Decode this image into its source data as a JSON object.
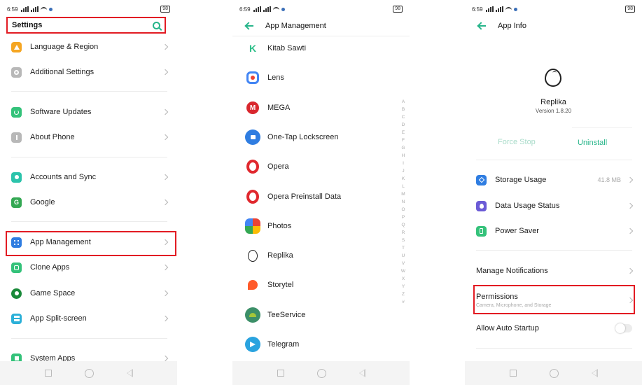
{
  "status": {
    "time": "6:59",
    "battery": "98"
  },
  "settings": {
    "title": "Settings",
    "items": [
      {
        "label": "Language & Region",
        "icon": "language-icon",
        "color": "#f5a623"
      },
      {
        "label": "Additional Settings",
        "icon": "gear-icon",
        "color": "#b8b8b8"
      },
      {
        "label": "Software Updates",
        "icon": "update-icon",
        "color": "#34c27a"
      },
      {
        "label": "About Phone",
        "icon": "info-icon",
        "color": "#b8b8b8"
      },
      {
        "label": "Accounts and Sync",
        "icon": "user-icon",
        "color": "#2cc3ab"
      },
      {
        "label": "Google",
        "icon": "google-icon",
        "color": "#34a853"
      },
      {
        "label": "App Management",
        "icon": "apps-icon",
        "color": "#2f7de1"
      },
      {
        "label": "Clone Apps",
        "icon": "clone-icon",
        "color": "#34c27a"
      },
      {
        "label": "Game Space",
        "icon": "game-icon",
        "color": "#1a8a3a"
      },
      {
        "label": "App Split-screen",
        "icon": "split-icon",
        "color": "#2cb0d8"
      },
      {
        "label": "System Apps",
        "icon": "system-apps-icon",
        "color": "#34c27a"
      }
    ]
  },
  "app_management": {
    "title": "App Management",
    "apps": [
      {
        "label": "Kitab Sawti",
        "color": "#2fbf8a"
      },
      {
        "label": "Lens",
        "color": "#4285f4"
      },
      {
        "label": "MEGA",
        "color": "#d9272e"
      },
      {
        "label": "One-Tap Lockscreen",
        "color": "#2f7de1"
      },
      {
        "label": "Opera",
        "color": "#e0282e"
      },
      {
        "label": "Opera Preinstall Data",
        "color": "#e0282e"
      },
      {
        "label": "Photos",
        "color": "#fbbc05"
      },
      {
        "label": "Replika",
        "color": "#ffffff"
      },
      {
        "label": "Storytel",
        "color": "#ff5a2a"
      },
      {
        "label": "TeeService",
        "color": "#3c8f68"
      },
      {
        "label": "Telegram",
        "color": "#2aa3df"
      }
    ],
    "alphabet": "A B C D E F G H I J K L M N O P Q R S T U V W X Y Z #"
  },
  "app_info": {
    "title": "App Info",
    "app_name": "Replika",
    "version": "Version 1.8.20",
    "force_stop": "Force Stop",
    "uninstall": "Uninstall",
    "storage_usage": "Storage Usage",
    "storage_value": "41.8 MB",
    "data_usage": "Data Usage Status",
    "power_saver": "Power Saver",
    "manage_notifications": "Manage Notifications",
    "permissions": "Permissions",
    "permissions_sub": "Camera, Microphone, and Storage",
    "auto_startup": "Allow Auto Startup"
  },
  "colors": {
    "accent": "#27b58a",
    "highlight": "#e21b23"
  }
}
